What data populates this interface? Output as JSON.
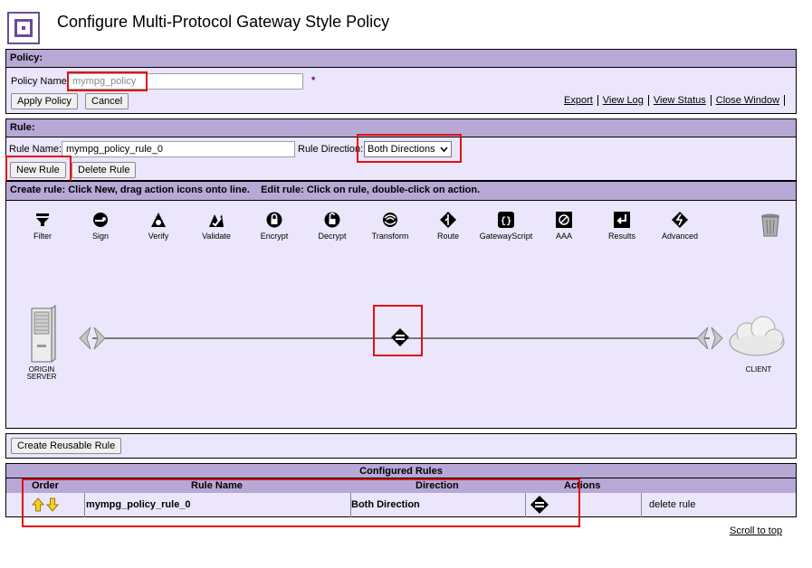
{
  "page": {
    "title": "Configure Multi-Protocol Gateway Style Policy"
  },
  "policy": {
    "header": "Policy:",
    "name_label": "Policy Name",
    "name_value": "mympg_policy",
    "required_mark": "*",
    "apply_label": "Apply Policy",
    "cancel_label": "Cancel",
    "links": [
      "Export",
      "View Log",
      "View Status",
      "Close Window"
    ]
  },
  "rule": {
    "header": "Rule:",
    "name_label": "Rule Name:",
    "name_value": "mympg_policy_rule_0",
    "direction_label": "Rule Direction:",
    "direction_value": "Both Directions",
    "new_rule_label": "New Rule",
    "delete_rule_label": "Delete Rule",
    "instructions": "Create rule: Click New, drag action icons onto line.    Edit rule: Click on rule, double-click on action."
  },
  "toolbar": {
    "actions": [
      {
        "label": "Filter",
        "icon": "filter-icon"
      },
      {
        "label": "Sign",
        "icon": "sign-icon"
      },
      {
        "label": "Verify",
        "icon": "verify-icon"
      },
      {
        "label": "Validate",
        "icon": "validate-icon"
      },
      {
        "label": "Encrypt",
        "icon": "encrypt-icon"
      },
      {
        "label": "Decrypt",
        "icon": "decrypt-icon"
      },
      {
        "label": "Transform",
        "icon": "transform-icon"
      },
      {
        "label": "Route",
        "icon": "route-icon"
      },
      {
        "label": "GatewayScript",
        "icon": "gatewayscript-icon"
      },
      {
        "label": "AAA",
        "icon": "aaa-icon"
      },
      {
        "label": "Results",
        "icon": "results-icon"
      },
      {
        "label": "Advanced",
        "icon": "advanced-icon"
      }
    ],
    "trash_icon": "trash-icon"
  },
  "canvas": {
    "origin_label_1": "ORIGIN",
    "origin_label_2": "SERVER",
    "client_label": "CLIENT"
  },
  "reusable": {
    "button_label": "Create Reusable Rule"
  },
  "configured": {
    "title": "Configured Rules",
    "columns": [
      "Order",
      "Rule Name",
      "Direction",
      "Actions"
    ],
    "rows": [
      {
        "rule_name": "mympg_policy_rule_0",
        "direction": "Both Direction",
        "delete_label": "delete rule"
      }
    ]
  },
  "footer": {
    "scroll_label": "Scroll to top"
  },
  "colors": {
    "header_bg": "#b7a8d6",
    "panel_bg": "#ebe6fb",
    "highlight": "#e01010",
    "brand": "#6b4c9a"
  }
}
